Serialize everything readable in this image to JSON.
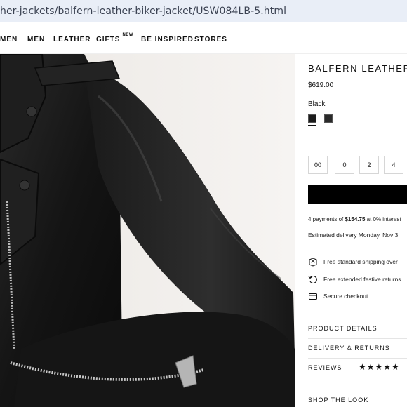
{
  "browser": {
    "url": "her-jackets/balfern-leather-biker-jacket/USW084LB-5.html"
  },
  "nav": {
    "items": [
      "MEN",
      "MEN",
      "LEATHER",
      "GIFTS",
      "BE INSPIRED",
      "STORES"
    ],
    "gifts_badge": "NEW"
  },
  "product": {
    "title": "BALFERN LEATHER BIKER JACKET",
    "price": "$619.00",
    "color_label": "Black",
    "swatches": [
      {
        "name": "Black",
        "color": "#1c1c1c"
      },
      {
        "name": "Black alt",
        "color": "#2a2a2a"
      }
    ],
    "sizes": [
      "00",
      "0",
      "2",
      "4"
    ],
    "add_to_bag_label": "",
    "payments": {
      "prefix": "4 payments of ",
      "amount": "$154.75",
      "suffix": " at 0% interest"
    },
    "delivery": "Estimated delivery Monday, Nov 3"
  },
  "perks": [
    {
      "icon": "shipping-box-icon",
      "text": "Free standard shipping over"
    },
    {
      "icon": "returns-arrow-icon",
      "text": "Free extended festive returns"
    },
    {
      "icon": "credit-card-icon",
      "text": "Secure checkout"
    }
  ],
  "accordion": {
    "product_details": "PRODUCT DETAILS",
    "delivery_returns": "DELIVERY & RETURNS",
    "reviews": "REVIEWS",
    "reviews_stars": "★★★★★",
    "rating": 5,
    "shop_the_look": "SHOP THE LOOK"
  }
}
